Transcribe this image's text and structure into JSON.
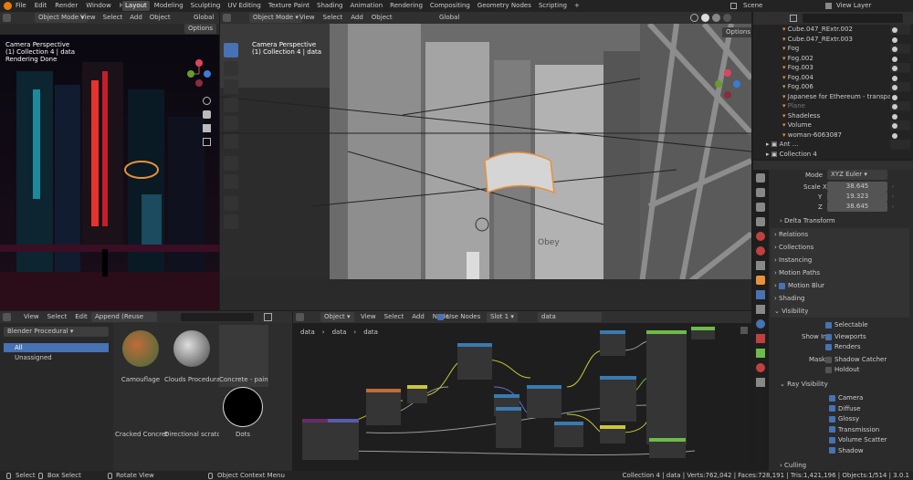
{
  "menu": {
    "items": [
      "File",
      "Edit",
      "Render",
      "Window",
      "Help"
    ],
    "tabs": [
      "Layout",
      "Modeling",
      "Sculpting",
      "UV Editing",
      "Texture Paint",
      "Shading",
      "Animation",
      "Rendering",
      "Compositing",
      "Geometry Nodes",
      "Scripting"
    ],
    "scene": "Scene",
    "view_layer": "View Layer"
  },
  "left_vp": {
    "mode": "Object Mode",
    "menus": [
      "View",
      "Select",
      "Add",
      "Object"
    ],
    "orient": "Global",
    "options": "Options",
    "overlay": [
      "Camera Perspective",
      "(1) Collection 4 | data",
      "Rendering Done"
    ]
  },
  "main_vp": {
    "mode": "Object Mode",
    "menus": [
      "View",
      "Select",
      "Add",
      "Object"
    ],
    "orient": "Global",
    "options": "Options",
    "overlay": [
      "Camera Perspective",
      "(1) Collection 4 | data"
    ],
    "sign": "Obey"
  },
  "outliner": {
    "items": [
      {
        "name": "Cube.047_RExtr.002",
        "dim": false
      },
      {
        "name": "Cube.047_RExtr.003",
        "dim": false
      },
      {
        "name": "Fog",
        "dim": false
      },
      {
        "name": "Fog.002",
        "dim": false
      },
      {
        "name": "Fog.003",
        "dim": false
      },
      {
        "name": "Fog.004",
        "dim": false
      },
      {
        "name": "Fog.006",
        "dim": false
      },
      {
        "name": "Japanese for Ethereum - transparent",
        "dim": false
      },
      {
        "name": "Plane",
        "dim": true
      },
      {
        "name": "Shadeless",
        "dim": false
      },
      {
        "name": "Volume",
        "dim": false
      },
      {
        "name": "woman-6063087",
        "dim": false
      }
    ],
    "collections": [
      "Ant",
      "Collection 4"
    ],
    "ant_suffix": "..."
  },
  "props": {
    "mode_label": "Mode",
    "mode_value": "XYZ Euler",
    "scale": [
      {
        "axis": "Scale X",
        "value": "38.645"
      },
      {
        "axis": "Y",
        "value": "19.323"
      },
      {
        "axis": "Z",
        "value": "38.645"
      }
    ],
    "delta": "Delta Transform",
    "sections": [
      "Relations",
      "Collections",
      "Instancing",
      "Motion Paths",
      "Motion Blur",
      "Shading",
      "Visibility"
    ],
    "selectable": "Selectable",
    "show_in": "Show In",
    "viewports": "Viewports",
    "renders": "Renders",
    "mask": "Mask",
    "shadow_catcher": "Shadow Catcher",
    "holdout": "Holdout",
    "ray_vis": "Ray Visibility",
    "rays": [
      "Camera",
      "Diffuse",
      "Glossy",
      "Transmission",
      "Volume Scatter",
      "Shadow"
    ],
    "culling": "Culling"
  },
  "browser": {
    "menus": [
      "View",
      "Select",
      "Edit"
    ],
    "library": "Append (Reuse Data)",
    "catalog": "Blender Procedural",
    "cats": [
      "All",
      "Unassigned"
    ],
    "assets": [
      "Camouflage",
      "Clouds Procedural ...",
      "Concrete - painted ...",
      "Cracked Concrete - ...",
      "Directional scratch...",
      "Dots"
    ]
  },
  "node": {
    "type": "Object",
    "menus": [
      "View",
      "Select",
      "Add",
      "Node"
    ],
    "use_nodes": "Use Nodes",
    "slot": "Slot 1",
    "material": "data",
    "crumbs": [
      "data",
      "data",
      "data"
    ]
  },
  "status": {
    "left": [
      "Select",
      "Box Select",
      "Rotate View",
      "Object Context Menu"
    ],
    "right": "Collection 4 | data | Verts:762,042 | Faces:728,191 | Tris:1,421,196 | Objects:1/514 | 3.0.1"
  },
  "colors": {
    "accent": "#4772b3",
    "orange": "#e8913a",
    "green": "#6dbb48"
  }
}
